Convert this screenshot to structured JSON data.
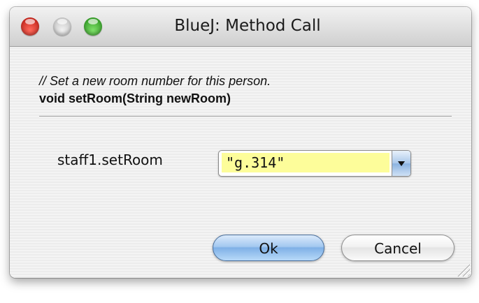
{
  "window": {
    "title": "BlueJ:  Method Call"
  },
  "method": {
    "comment": "// Set a new room number for this person.",
    "signature": "void setRoom(String newRoom)"
  },
  "call": {
    "label": "staff1.setRoom",
    "argument_value": "\"g.314\""
  },
  "buttons": {
    "ok_label": "Ok",
    "cancel_label": "Cancel"
  },
  "colors": {
    "input_highlight": "#fdfd9a",
    "default_button": "#8ab2e0",
    "close": "#e0362b",
    "zoom": "#3cb82a"
  }
}
